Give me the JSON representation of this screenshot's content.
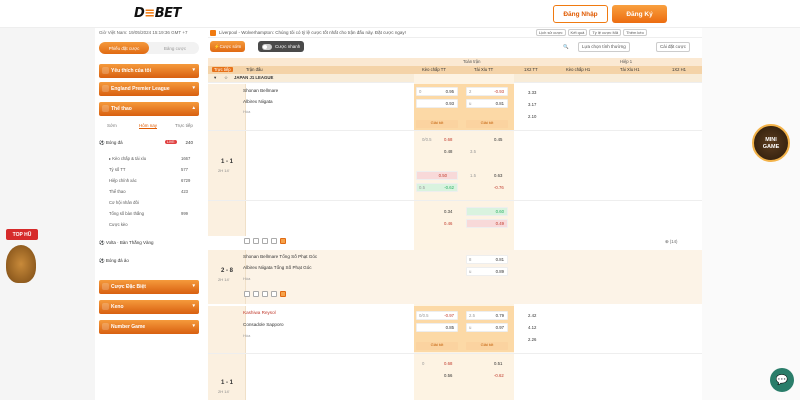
{
  "header": {
    "logo_left": "D",
    "logo_mid": "≡",
    "logo_right": "BET",
    "login": "Đăng Nhập",
    "register": "Đăng Ký"
  },
  "sidebar": {
    "datetime": "Giờ Việt Nam: 19/05/2024 15:19:36 GMT +7",
    "tab_a": "Phiếu đặt cược",
    "tab_b": "Bảng cược",
    "fav": "Yêu thích của tôi",
    "epl": "England Premier League",
    "sports": "Thể thao",
    "subtabs": [
      "Sớm",
      "Hôm nay",
      "Trực tiếp"
    ],
    "football": "Bóng đá",
    "football_badge": "LIVE",
    "football_count": "240",
    "list": [
      {
        "label": "Kèo chấp & tài xỉu",
        "n": "1667"
      },
      {
        "label": "Tỷ số TT",
        "n": "577"
      },
      {
        "label": "Hiệp chính xác",
        "n": "6729"
      },
      {
        "label": "Thể thao",
        "n": "423"
      },
      {
        "label": "Cơ hội nhân đôi",
        "n": ""
      },
      {
        "label": "Tổng số bàn thắng",
        "n": "999"
      },
      {
        "label": "Cược kèo",
        "n": ""
      }
    ],
    "volta": "Volta · Bàn Thắng Vàng",
    "bongda_ao": "Bóng đá ảo",
    "special": "Cược Đặc Biệt",
    "keno": "Keno",
    "number_game": "Number Game"
  },
  "notice": {
    "text": "Liverpool - Wolverhampton: Chúng tôi có tỷ lệ cược tốt nhất cho trận đấu này. Đặt cược ngay!",
    "btns": [
      "Lịch sử cược",
      "Kết quả",
      "Tỷ lệ cược Mã",
      "Thêm kèo"
    ]
  },
  "filter": {
    "chip1": "Cược sớm",
    "chip2": "Cược nhanh",
    "sort": "Lựa chọn tính thường",
    "settings": "Cài đặt cược"
  },
  "table": {
    "top_full": "Toàn trận",
    "top_half": "Hiệp 1",
    "live": "Trực tiếp",
    "col_time": "Trận đấu",
    "cols": [
      "Kèo chấp TT",
      "Tài Xỉu TT",
      "1X2 TT",
      "Kèo chấp H1",
      "Tài Xỉu H1",
      "1X2 H1"
    ],
    "league": "JAPAN J1 LEAGUE"
  },
  "m1": {
    "score": "1 - 1",
    "min": "2H 14'",
    "home": "Shonan Bellmare",
    "away": "Albirex Niigata",
    "draw": "Hòa",
    "hc": [
      [
        "0",
        "0.95"
      ],
      [
        "",
        "0.93"
      ]
    ],
    "ou": [
      [
        "2",
        "-0.93"
      ],
      [
        "u",
        "0.81"
      ]
    ],
    "x12": [
      "3.33",
      "3.17",
      "2.10"
    ],
    "more": "Giải tốt",
    "rows2": [
      [
        "0/0.5",
        "0.68",
        "0.45"
      ],
      [
        "",
        "0.48",
        "3.5"
      ]
    ],
    "rows3": [
      [
        "0.50",
        "1.5",
        "0.63"
      ],
      [
        "0.5",
        "-0.62",
        "-0.76"
      ]
    ],
    "rows4": [
      [
        "0.34",
        "0.60"
      ],
      [
        "0.46",
        "0.49"
      ]
    ],
    "footer_count": "(14)"
  },
  "m2": {
    "score": "2 - 8",
    "min": "2H 14'",
    "home": "Shonan Bellmare Tổng Số Phạt Góc",
    "away": "Albirex Niigata Tổng Số Phạt Góc",
    "draw": "Hòa",
    "ou": [
      [
        "8",
        "0.81"
      ],
      [
        "u",
        "0.89"
      ]
    ]
  },
  "m3": {
    "home": "Kashiwa Reysol",
    "away": "Consadole Sapporo",
    "draw": "Hòa",
    "hc": [
      [
        "0/0.5",
        "-0.97"
      ],
      [
        "",
        "0.85"
      ]
    ],
    "ou": [
      [
        "2.5",
        "0.79"
      ],
      [
        "u",
        "0.97"
      ]
    ],
    "x12": [
      "2.42",
      "4.12",
      "2.26"
    ],
    "rows2": [
      [
        "0",
        "0.68",
        "0.51"
      ],
      [
        "",
        "0.56",
        "-0.62"
      ]
    ],
    "score": "1 - 1",
    "min": "2H 14'"
  },
  "promo": {
    "top_hu": "TOP HŨ",
    "mini_game_a": "MINI",
    "mini_game_b": "GAME"
  }
}
